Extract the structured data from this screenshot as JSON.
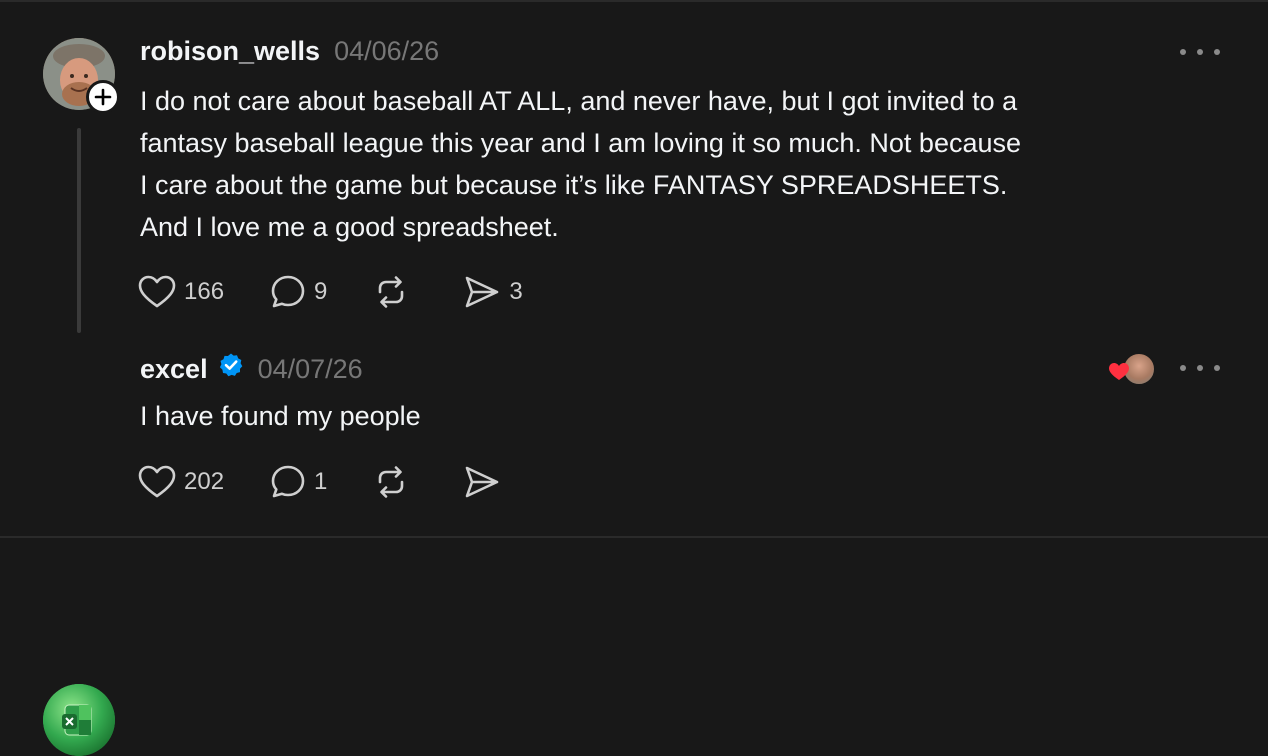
{
  "posts": [
    {
      "username": "robison_wells",
      "date": "04/06/26",
      "lines": [
        "I do not care about baseball AT ALL, and never have, but I got invited to a",
        "fantasy baseball league this year and I am loving it so much. Not because",
        "I care about the game but because it’s like FANTASY SPREADSHEETS.",
        "And I love me a good spreadsheet."
      ],
      "likes": "166",
      "replies": "9",
      "reposts": "",
      "shares": "3"
    },
    {
      "username": "excel",
      "date": "04/07/26",
      "verified": true,
      "lines": [
        "I have found my people"
      ],
      "likes": "202",
      "replies": "1",
      "reposts": "",
      "shares": ""
    }
  ],
  "colors": {
    "background": "#181818",
    "text": "#f3f5f7",
    "muted": "#777777",
    "verified": "#0095f6",
    "like_heart": "#ff3040"
  },
  "icons": [
    "plus-icon",
    "heart-icon",
    "comment-icon",
    "repost-icon",
    "share-icon",
    "more-icon",
    "verified-icon"
  ]
}
